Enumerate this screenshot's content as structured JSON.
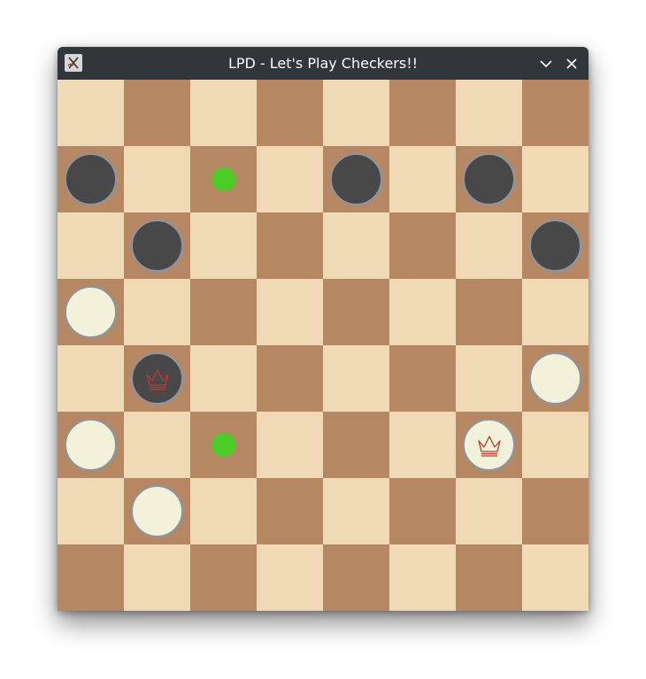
{
  "window": {
    "title": "LPD - Let's Play Checkers!!",
    "icons": {
      "app": "checkers-app-icon",
      "minimize": "chevron-down-icon",
      "close": "close-icon"
    },
    "colors": {
      "titlebar": "#31363b",
      "title_text": "#fcfcfc"
    }
  },
  "board": {
    "rows": 8,
    "cols": 8,
    "colors": {
      "light_square": "#f0d9b5",
      "dark_square": "#b58863",
      "dark_piece": "#484848",
      "light_piece": "#f2f2da",
      "piece_border": "#8a95a5",
      "crown": "#c0392b",
      "move_hint": "#4acd26"
    },
    "pieces": [
      {
        "row": 1,
        "col": 0,
        "color": "dark",
        "king": false
      },
      {
        "row": 1,
        "col": 4,
        "color": "dark",
        "king": false
      },
      {
        "row": 1,
        "col": 6,
        "color": "dark",
        "king": false
      },
      {
        "row": 2,
        "col": 1,
        "color": "dark",
        "king": false
      },
      {
        "row": 2,
        "col": 7,
        "color": "dark",
        "king": false
      },
      {
        "row": 3,
        "col": 0,
        "color": "light",
        "king": false
      },
      {
        "row": 4,
        "col": 1,
        "color": "dark",
        "king": true
      },
      {
        "row": 4,
        "col": 7,
        "color": "light",
        "king": false
      },
      {
        "row": 5,
        "col": 0,
        "color": "light",
        "king": false
      },
      {
        "row": 5,
        "col": 6,
        "color": "light",
        "king": true
      },
      {
        "row": 6,
        "col": 1,
        "color": "light",
        "king": false
      }
    ],
    "move_hints": [
      {
        "row": 1,
        "col": 2
      },
      {
        "row": 5,
        "col": 2
      }
    ]
  }
}
